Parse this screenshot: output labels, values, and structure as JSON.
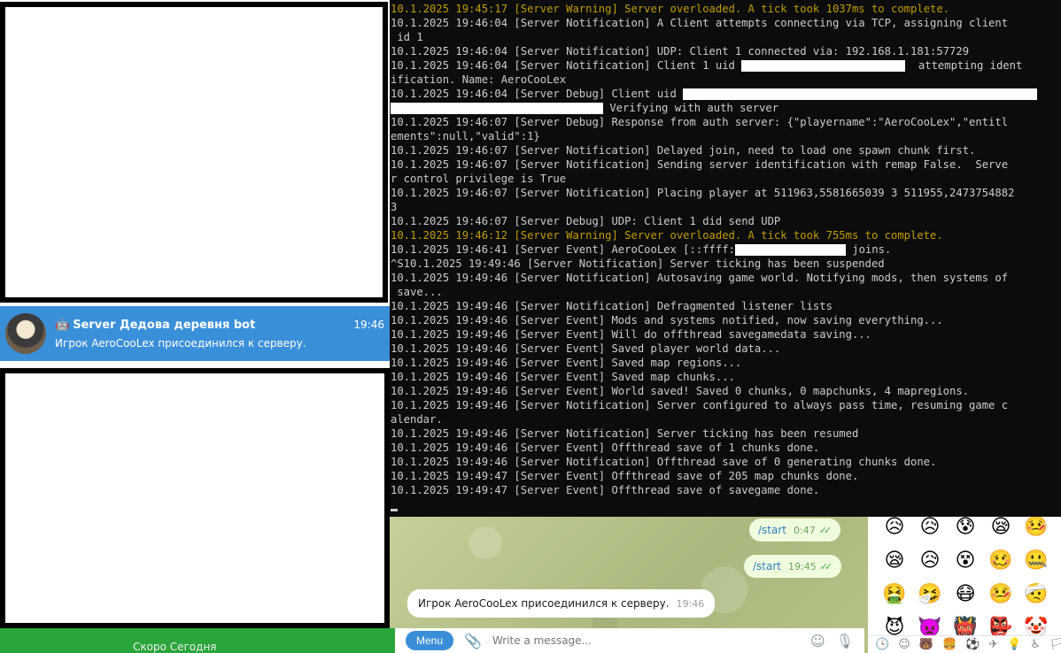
{
  "chat_list": {
    "selected": {
      "name": "Server Дедова деревня bot",
      "bot_icon": "bot-icon",
      "time": "19:46",
      "preview": "Игрок AeroCooLex присоединился к серверу."
    },
    "bottom_partial_text": "Скоро Сегодня"
  },
  "chat": {
    "messages": [
      {
        "text": "/start",
        "time": "0:47",
        "direction": "out"
      },
      {
        "text": "/start",
        "time": "19:45",
        "direction": "out"
      },
      {
        "text": "Игрок AeroCooLex присоединился к серверу.",
        "time": "19:46",
        "direction": "in"
      }
    ],
    "composer": {
      "menu_label": "Menu",
      "placeholder": "Write a message..."
    }
  },
  "emoji": {
    "rows": [
      [
        "😥",
        "😥",
        "😰",
        "😪",
        "🤒"
      ],
      [
        "😪",
        "😥",
        "😵",
        "🥴",
        "🤐"
      ],
      [
        "🤮",
        "🤧",
        "😷",
        "🤒",
        "🤕"
      ],
      [
        "😈",
        "👿",
        "👹",
        "👺",
        "🤡"
      ]
    ],
    "tabs": [
      "🕓",
      "☺",
      "🐻",
      "🍔",
      "⚽",
      "✈",
      "💡",
      "♿",
      "🏳"
    ]
  },
  "terminal": {
    "lines": [
      {
        "t": "10.1.2025 19:45:17 [Server Warning] Server overloaded. A tick took 1037ms to complete.",
        "c": "warn"
      },
      {
        "t": "10.1.2025 19:46:04 [Server Notification] A Client attempts connecting via TCP, assigning client"
      },
      {
        "t": " id 1"
      },
      {
        "t": "10.1.2025 19:46:04 [Server Notification] UDP: Client 1 connected via: 192.168.1.181:57729"
      },
      {
        "t": "10.1.2025 19:46:04 [Server Notification] Client 1 uid ",
        "redact": 185,
        "after": "  attempting ident"
      },
      {
        "t": "ification. Name: AeroCooLex"
      },
      {
        "t": "10.1.2025 19:46:04 [Server Debug] Client uid ",
        "redact": 400,
        "after": ""
      },
      {
        "t": "",
        "redact": 240,
        "after": " Verifying with auth server"
      },
      {
        "t": "10.1.2025 19:46:07 [Server Debug] Response from auth server: {\"playername\":\"AeroCooLex\",\"entitl"
      },
      {
        "t": "ements\":null,\"valid\":1}"
      },
      {
        "t": "10.1.2025 19:46:07 [Server Notification] Delayed join, need to load one spawn chunk first."
      },
      {
        "t": "10.1.2025 19:46:07 [Server Notification] Sending server identification with remap False.  Serve"
      },
      {
        "t": "r control privilege is True"
      },
      {
        "t": "10.1.2025 19:46:07 [Server Notification] Placing player at 511963,5581665039 3 511955,2473754882"
      },
      {
        "t": "3"
      },
      {
        "t": "10.1.2025 19:46:07 [Server Debug] UDP: Client 1 did send UDP"
      },
      {
        "t": "10.1.2025 19:46:12 [Server Warning] Server overloaded. A tick took 755ms to complete.",
        "c": "warn"
      },
      {
        "t": "10.1.2025 19:46:41 [Server Event] AeroCooLex [::ffff:",
        "redact": 125,
        "after": " joins."
      },
      {
        "t": "^S10.1.2025 19:49:46 [Server Notification] Server ticking has been suspended"
      },
      {
        "t": "10.1.2025 19:49:46 [Server Notification] Autosaving game world. Notifying mods, then systems of"
      },
      {
        "t": " save..."
      },
      {
        "t": "10.1.2025 19:49:46 [Server Notification] Defragmented listener lists"
      },
      {
        "t": "10.1.2025 19:49:46 [Server Event] Mods and systems notified, now saving everything..."
      },
      {
        "t": "10.1.2025 19:49:46 [Server Event] Will do offthread savegamedata saving..."
      },
      {
        "t": "10.1.2025 19:49:46 [Server Event] Saved player world data..."
      },
      {
        "t": "10.1.2025 19:49:46 [Server Event] Saved map regions..."
      },
      {
        "t": "10.1.2025 19:49:46 [Server Event] Saved map chunks..."
      },
      {
        "t": "10.1.2025 19:49:46 [Server Event] World saved! Saved 0 chunks, 0 mapchunks, 4 mapregions."
      },
      {
        "t": "10.1.2025 19:49:46 [Server Notification] Server configured to always pass time, resuming game c"
      },
      {
        "t": "alendar."
      },
      {
        "t": "10.1.2025 19:49:46 [Server Notification] Server ticking has been resumed"
      },
      {
        "t": "10.1.2025 19:49:46 [Server Event] Offthread save of 1 chunks done."
      },
      {
        "t": "10.1.2025 19:49:46 [Server Notification] Offthread save of 0 generating chunks done."
      },
      {
        "t": "10.1.2025 19:49:47 [Server Event] Offthread save of 205 map chunks done."
      },
      {
        "t": "10.1.2025 19:49:47 [Server Event] Offthread save of savegame done."
      }
    ]
  }
}
